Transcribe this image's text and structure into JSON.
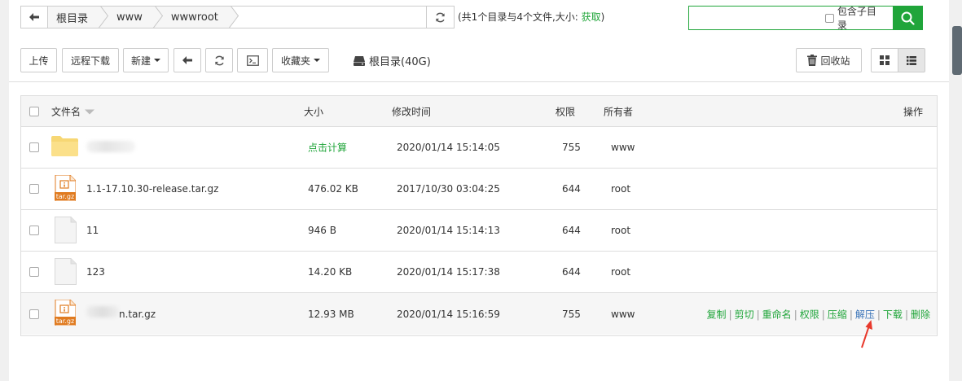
{
  "path": {
    "crumbs": [
      "根目录",
      "www",
      "wwwroot"
    ]
  },
  "summary": {
    "text": "(共1个目录与4个文件,大小:",
    "get_link": "获取",
    "close": ")"
  },
  "search": {
    "placeholder": "",
    "include_subdir_label": "包含子目录"
  },
  "toolbar": {
    "upload": "上传",
    "remote_download": "远程下载",
    "new": "新建",
    "favorites": "收藏夹",
    "disk_label": "根目录(40G)",
    "recycle": "回收站"
  },
  "table": {
    "headers": {
      "name": "文件名",
      "size": "大小",
      "mtime": "修改时间",
      "perm": "权限",
      "owner": "所有者",
      "ops": "操作"
    },
    "rows": [
      {
        "name": "",
        "size": "点击计算",
        "mtime": "2020/01/14 15:14:05",
        "perm": "755",
        "owner": "www",
        "type": "folder"
      },
      {
        "name": "1.1-17.10.30-release.tar.gz",
        "size": "476.02 KB",
        "mtime": "2017/10/30 03:04:25",
        "perm": "644",
        "owner": "root",
        "type": "archive"
      },
      {
        "name": "11",
        "size": "946 B",
        "mtime": "2020/01/14 15:14:13",
        "perm": "644",
        "owner": "root",
        "type": "file"
      },
      {
        "name": "123",
        "size": "14.20 KB",
        "mtime": "2020/01/14 15:17:38",
        "perm": "644",
        "owner": "root",
        "type": "file"
      },
      {
        "name": "n.tar.gz",
        "size": "12.93 MB",
        "mtime": "2020/01/14 15:16:59",
        "perm": "755",
        "owner": "www",
        "type": "archive"
      }
    ],
    "archive_badge": "tar.gz",
    "row_actions": [
      "复制",
      "剪切",
      "重命名",
      "权限",
      "压缩",
      "解压",
      "下载",
      "删除"
    ]
  },
  "colors": {
    "accent": "#20a53a",
    "highlight_link": "#3a74b8",
    "annotation_arrow": "#e8392c"
  }
}
